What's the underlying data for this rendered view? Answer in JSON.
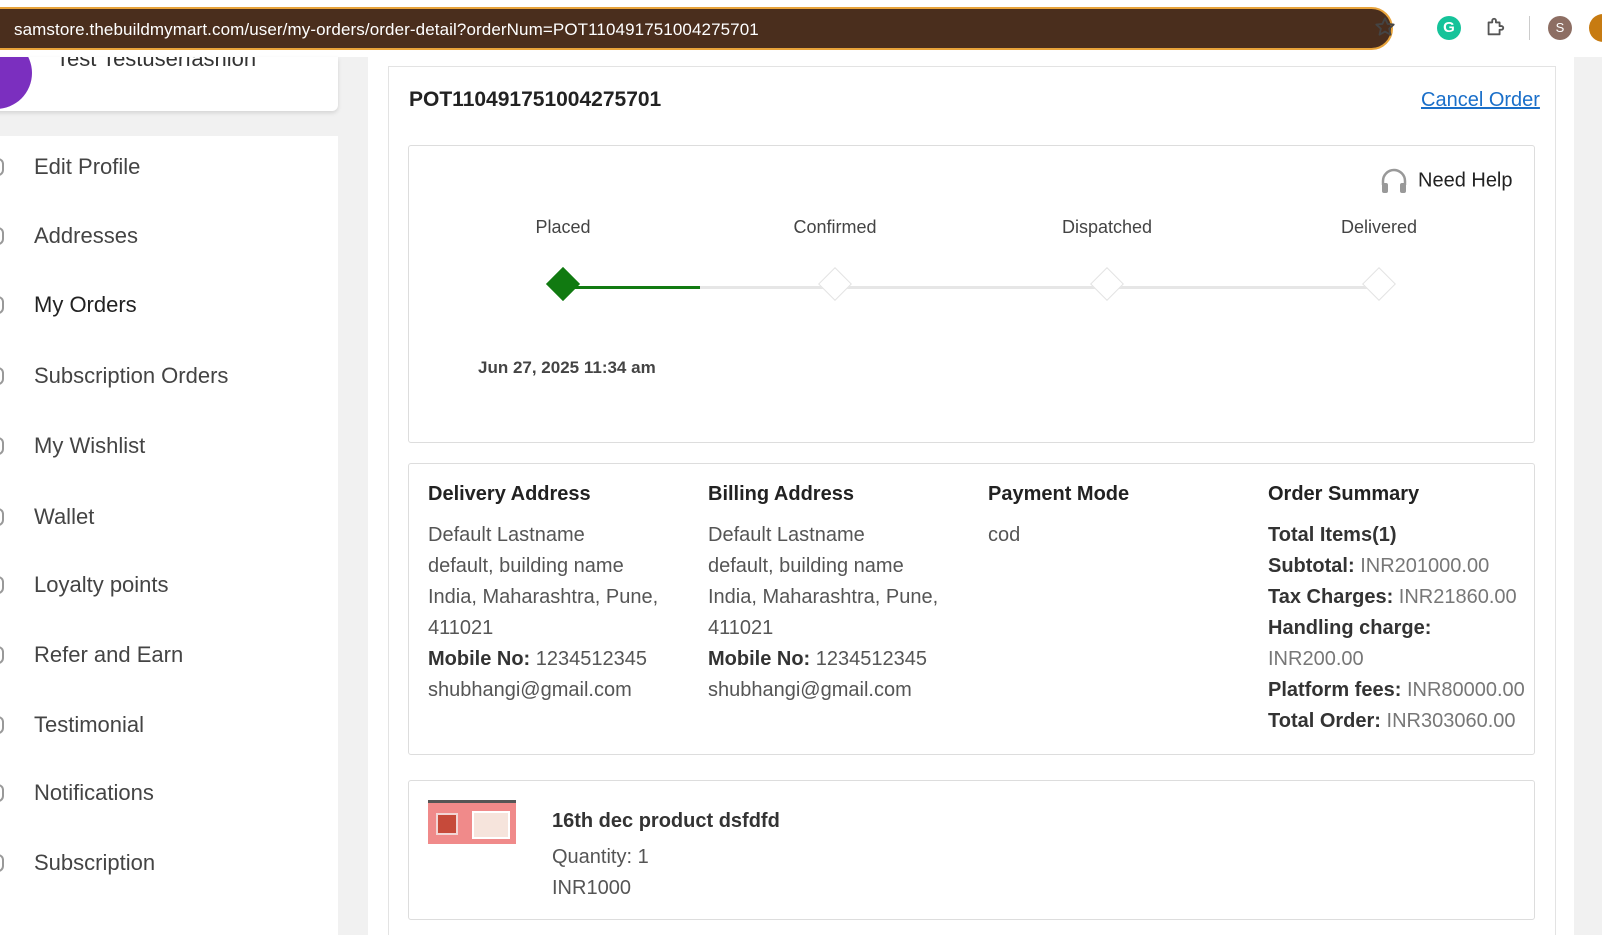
{
  "browser": {
    "url": "samstore.thebuildmymart.com/user/my-orders/order-detail?orderNum=POT110491751004275701",
    "profile_initial": "S",
    "grammarly_letter": "G"
  },
  "user": {
    "name": "Test Testuserfashion",
    "avatar_color": "#7b2fbf"
  },
  "menu": {
    "items": [
      {
        "label": "Edit Profile"
      },
      {
        "label": "Addresses"
      },
      {
        "label": "My Orders"
      },
      {
        "label": "Subscription Orders"
      },
      {
        "label": "My Wishlist"
      },
      {
        "label": "Wallet"
      },
      {
        "label": "Loyalty points"
      },
      {
        "label": "Refer and Earn"
      },
      {
        "label": "Testimonial"
      },
      {
        "label": "Notifications"
      },
      {
        "label": "Subscription"
      }
    ],
    "active": "My Orders"
  },
  "order": {
    "id": "POT110491751004275701",
    "cancel_label": "Cancel Order",
    "need_help_label": "Need Help",
    "steps": [
      {
        "label": "Placed",
        "done": true
      },
      {
        "label": "Confirmed",
        "done": false
      },
      {
        "label": "Dispatched",
        "done": false
      },
      {
        "label": "Delivered",
        "done": false
      }
    ],
    "placed_date": "Jun 27, 2025 11:34 am",
    "progress_color": "#117a11"
  },
  "delivery_address": {
    "title": "Delivery Address",
    "name": "Default Lastname",
    "line1": "default, building name",
    "line2": "India, Maharashtra, Pune,",
    "pincode": "411021",
    "mobile_label": "Mobile No:",
    "mobile": "1234512345",
    "email": "shubhangi@gmail.com"
  },
  "billing_address": {
    "title": "Billing Address",
    "name": "Default Lastname",
    "line1": "default, building name",
    "line2": "India, Maharashtra, Pune,",
    "pincode": "411021",
    "mobile_label": "Mobile No:",
    "mobile": "1234512345",
    "email": "shubhangi@gmail.com"
  },
  "payment": {
    "title": "Payment Mode",
    "mode": "cod"
  },
  "summary": {
    "title": "Order Summary",
    "total_items": "Total Items(1)",
    "subtotal_label": "Subtotal:",
    "subtotal": "INR201000.00",
    "tax_label": "Tax Charges:",
    "tax": "INR21860.00",
    "handling_label": "Handling charge:",
    "handling": "INR200.00",
    "platform_label": "Platform fees:",
    "platform": "INR80000.00",
    "total_label": "Total Order:",
    "total": "INR303060.00"
  },
  "product": {
    "name": "16th dec product dsfdfd",
    "quantity": "Quantity: 1",
    "price": "INR1000"
  }
}
